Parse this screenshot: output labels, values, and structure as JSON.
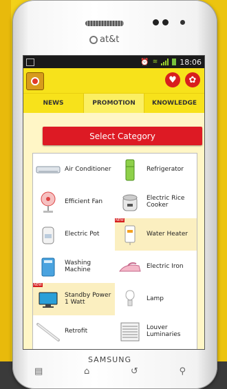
{
  "phone": {
    "carrier": "at&t",
    "brand": "SAMSUNG",
    "nav_keys": [
      "menu-key",
      "home-key",
      "back-key",
      "search-key"
    ]
  },
  "status_bar": {
    "time": "18:06"
  },
  "app": {
    "tabs": [
      {
        "label": "NEWS",
        "active": false
      },
      {
        "label": "PROMOTION",
        "active": true
      },
      {
        "label": "KNOWLEDGE",
        "active": false
      }
    ],
    "select_category": "Select Category",
    "categories": [
      {
        "label": "Air Conditioner",
        "icon": "air-conditioner-icon",
        "highlight": false,
        "new": false
      },
      {
        "label": "Refrigerator",
        "icon": "refrigerator-icon",
        "highlight": false,
        "new": false
      },
      {
        "label": "Efficient Fan",
        "icon": "fan-icon",
        "highlight": false,
        "new": false
      },
      {
        "label": "Electric Rice Cooker",
        "icon": "rice-cooker-icon",
        "highlight": false,
        "new": false
      },
      {
        "label": "Electric Pot",
        "icon": "electric-pot-icon",
        "highlight": false,
        "new": false
      },
      {
        "label": "Water Heater",
        "icon": "water-heater-icon",
        "highlight": true,
        "new": true
      },
      {
        "label": "Washing Machine",
        "icon": "washing-machine-icon",
        "highlight": false,
        "new": false
      },
      {
        "label": "Electric Iron",
        "icon": "iron-icon",
        "highlight": false,
        "new": false
      },
      {
        "label": "Standby Power 1 Watt",
        "icon": "monitor-icon",
        "highlight": true,
        "new": true
      },
      {
        "label": "Lamp",
        "icon": "lamp-icon",
        "highlight": false,
        "new": false
      },
      {
        "label": "Retrofit",
        "icon": "retrofit-tube-icon",
        "highlight": false,
        "new": false
      },
      {
        "label": "Louver Luminaries",
        "icon": "louver-icon",
        "highlight": false,
        "new": false
      }
    ],
    "new_badge": "NEW"
  }
}
